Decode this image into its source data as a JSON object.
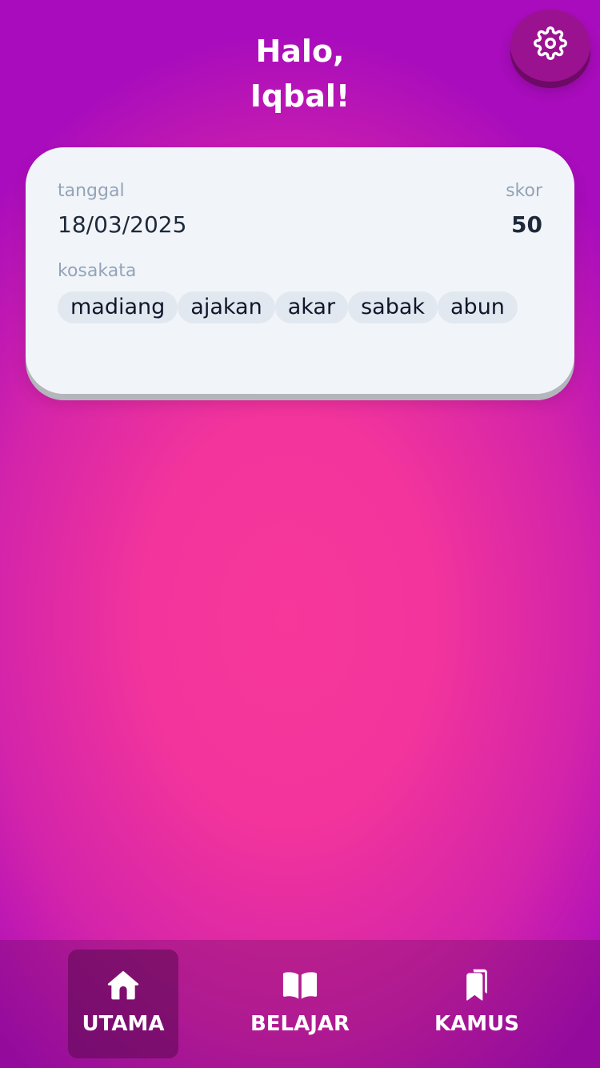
{
  "header": {
    "greeting_line1": "Halo,",
    "greeting_line2": "Iqbal!",
    "settings_icon": "gear-icon"
  },
  "card": {
    "date_label": "tanggal",
    "date_value": "18/03/2025",
    "score_label": "skor",
    "score_value": "50",
    "vocab_label": "kosakata",
    "vocab": [
      "madiang",
      "ajakan",
      "akar",
      "sabak",
      "abun"
    ]
  },
  "nav": {
    "items": [
      {
        "label": "UTAMA",
        "icon": "home-icon",
        "active": true
      },
      {
        "label": "BELAJAR",
        "icon": "book-icon",
        "active": false
      },
      {
        "label": "KAMUS",
        "icon": "bookmark-book-icon",
        "active": false
      }
    ]
  },
  "colors": {
    "background": "#f2349c",
    "card": "#f1f5f9",
    "chip": "#e2e8f0",
    "muted_text": "#94a3b8",
    "dark_text": "#1e293b"
  }
}
